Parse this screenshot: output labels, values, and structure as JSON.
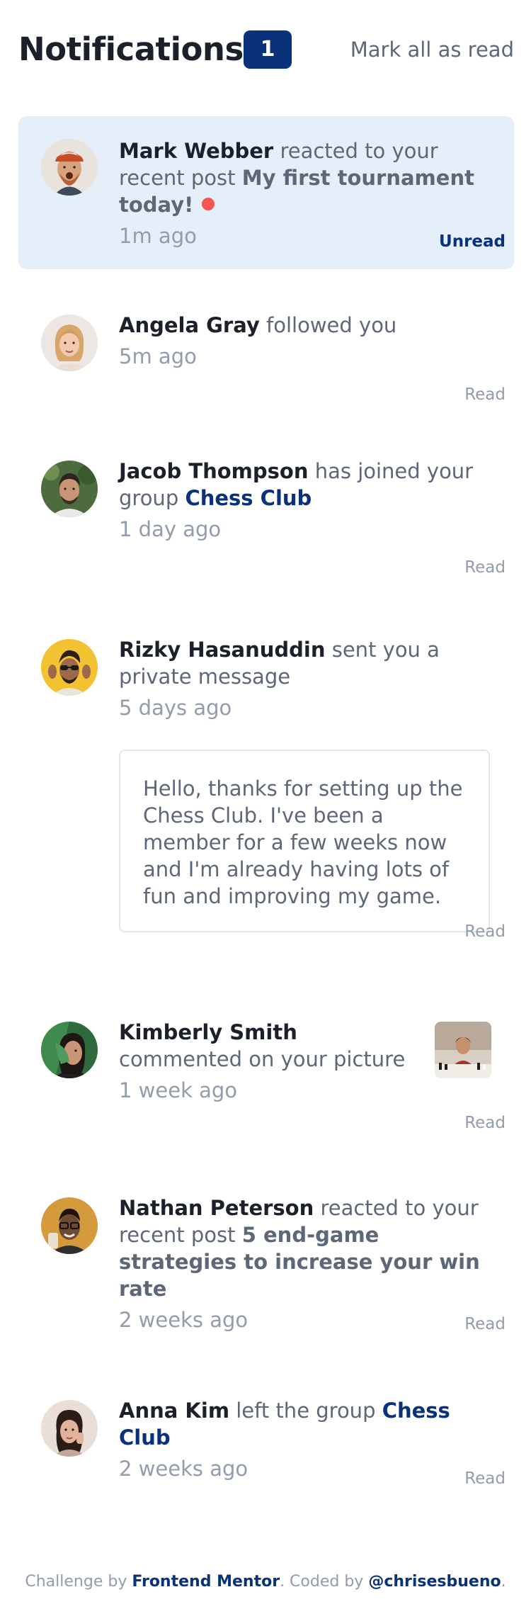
{
  "header": {
    "title": "Notifications",
    "unread_count": "1",
    "mark_all_label": "Mark all as read"
  },
  "notifications": [
    {
      "name": "Mark Webber",
      "action": "reacted to your recent post",
      "post": "My first tournament today!",
      "time": "1m ago",
      "status": "Unread",
      "avatar_icon": "avatar-mark-webber"
    },
    {
      "name": "Angela Gray",
      "action": "followed you",
      "time": "5m ago",
      "status": "Read",
      "avatar_icon": "avatar-angela-gray"
    },
    {
      "name": "Jacob Thompson",
      "action": "has joined your group",
      "group": "Chess Club",
      "time": "1 day ago",
      "status": "Read",
      "avatar_icon": "avatar-jacob-thompson"
    },
    {
      "name": "Rizky Hasanuddin",
      "action": "sent you a private message",
      "time": "5 days ago",
      "message": "Hello, thanks for setting up the Chess Club. I've been a member for a few weeks now and I'm already having lots of fun and improving my game.",
      "status": "Read",
      "avatar_icon": "avatar-rizky-hasanuddin"
    },
    {
      "name": "Kimberly Smith",
      "action": "commented on your picture",
      "time": "1 week ago",
      "status": "Read",
      "avatar_icon": "avatar-kimberly-smith",
      "picture_icon": "chess-picture-thumbnail"
    },
    {
      "name": "Nathan Peterson",
      "action": "reacted to your recent post",
      "post": "5 end-game strategies to increase your win rate",
      "time": "2 weeks ago",
      "status": "Read",
      "avatar_icon": "avatar-nathan-peterson"
    },
    {
      "name": "Anna Kim",
      "action": "left the group",
      "group": "Chess Club",
      "time": "2 weeks ago",
      "status": "Read",
      "avatar_icon": "avatar-anna-kim"
    }
  ],
  "footer": {
    "challenge_prefix": "Challenge by",
    "challenge_link": "Frontend Mentor",
    "coded_prefix": ". Coded by",
    "coded_link": "@chrisesbueno",
    "suffix": "."
  },
  "colors": {
    "unread_bg": "#e5effa",
    "badge": "#0a327b",
    "red_dot": "#f65552",
    "heading": "#1c202b",
    "muted": "#939cad"
  }
}
